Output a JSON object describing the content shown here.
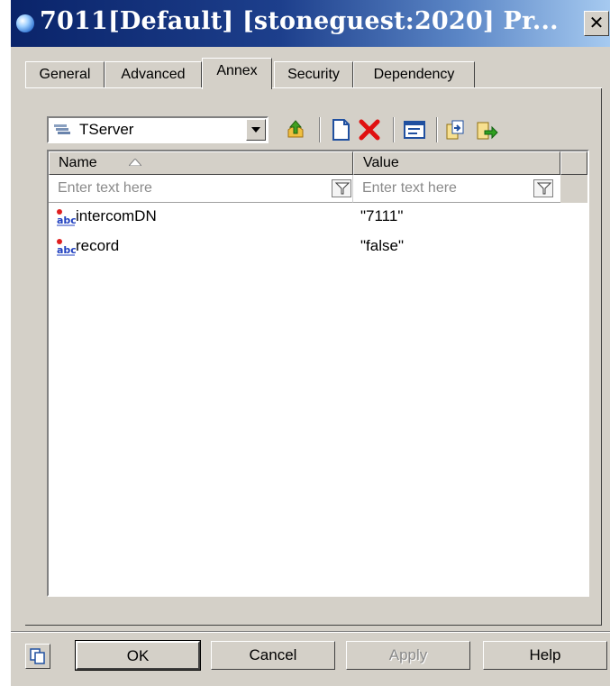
{
  "window": {
    "title": "7011[Default] [stoneguest:2020] Pr...",
    "close_glyph": "✕"
  },
  "tabs": [
    {
      "label": "General",
      "active": false
    },
    {
      "label": "Advanced",
      "active": false
    },
    {
      "label": "Annex",
      "active": true
    },
    {
      "label": "Security",
      "active": false
    },
    {
      "label": "Dependency",
      "active": false
    }
  ],
  "section_selector": {
    "value": "TServer",
    "icon": "tserver-icon"
  },
  "toolbar": {
    "items": [
      "go-up-icon",
      "new-section-icon",
      "delete-icon",
      "edit-icon",
      "import-icon",
      "export-icon"
    ]
  },
  "grid": {
    "columns": [
      {
        "label": "Name",
        "sort": "ascending"
      },
      {
        "label": "Value"
      }
    ],
    "filter_placeholder": "Enter text here",
    "rows": [
      {
        "name": "intercomDN",
        "value": "\"7111\"",
        "icon": "string-option-icon"
      },
      {
        "name": "record",
        "value": "\"false\"",
        "icon": "string-option-icon"
      }
    ]
  },
  "buttons": {
    "ok": "OK",
    "cancel": "Cancel",
    "apply": "Apply",
    "help": "Help",
    "apply_enabled": false
  },
  "colors": {
    "titlebar_start": "#0a246a",
    "titlebar_end": "#a6caf0",
    "face": "#d4d0c8",
    "delete_red": "#e01010"
  }
}
